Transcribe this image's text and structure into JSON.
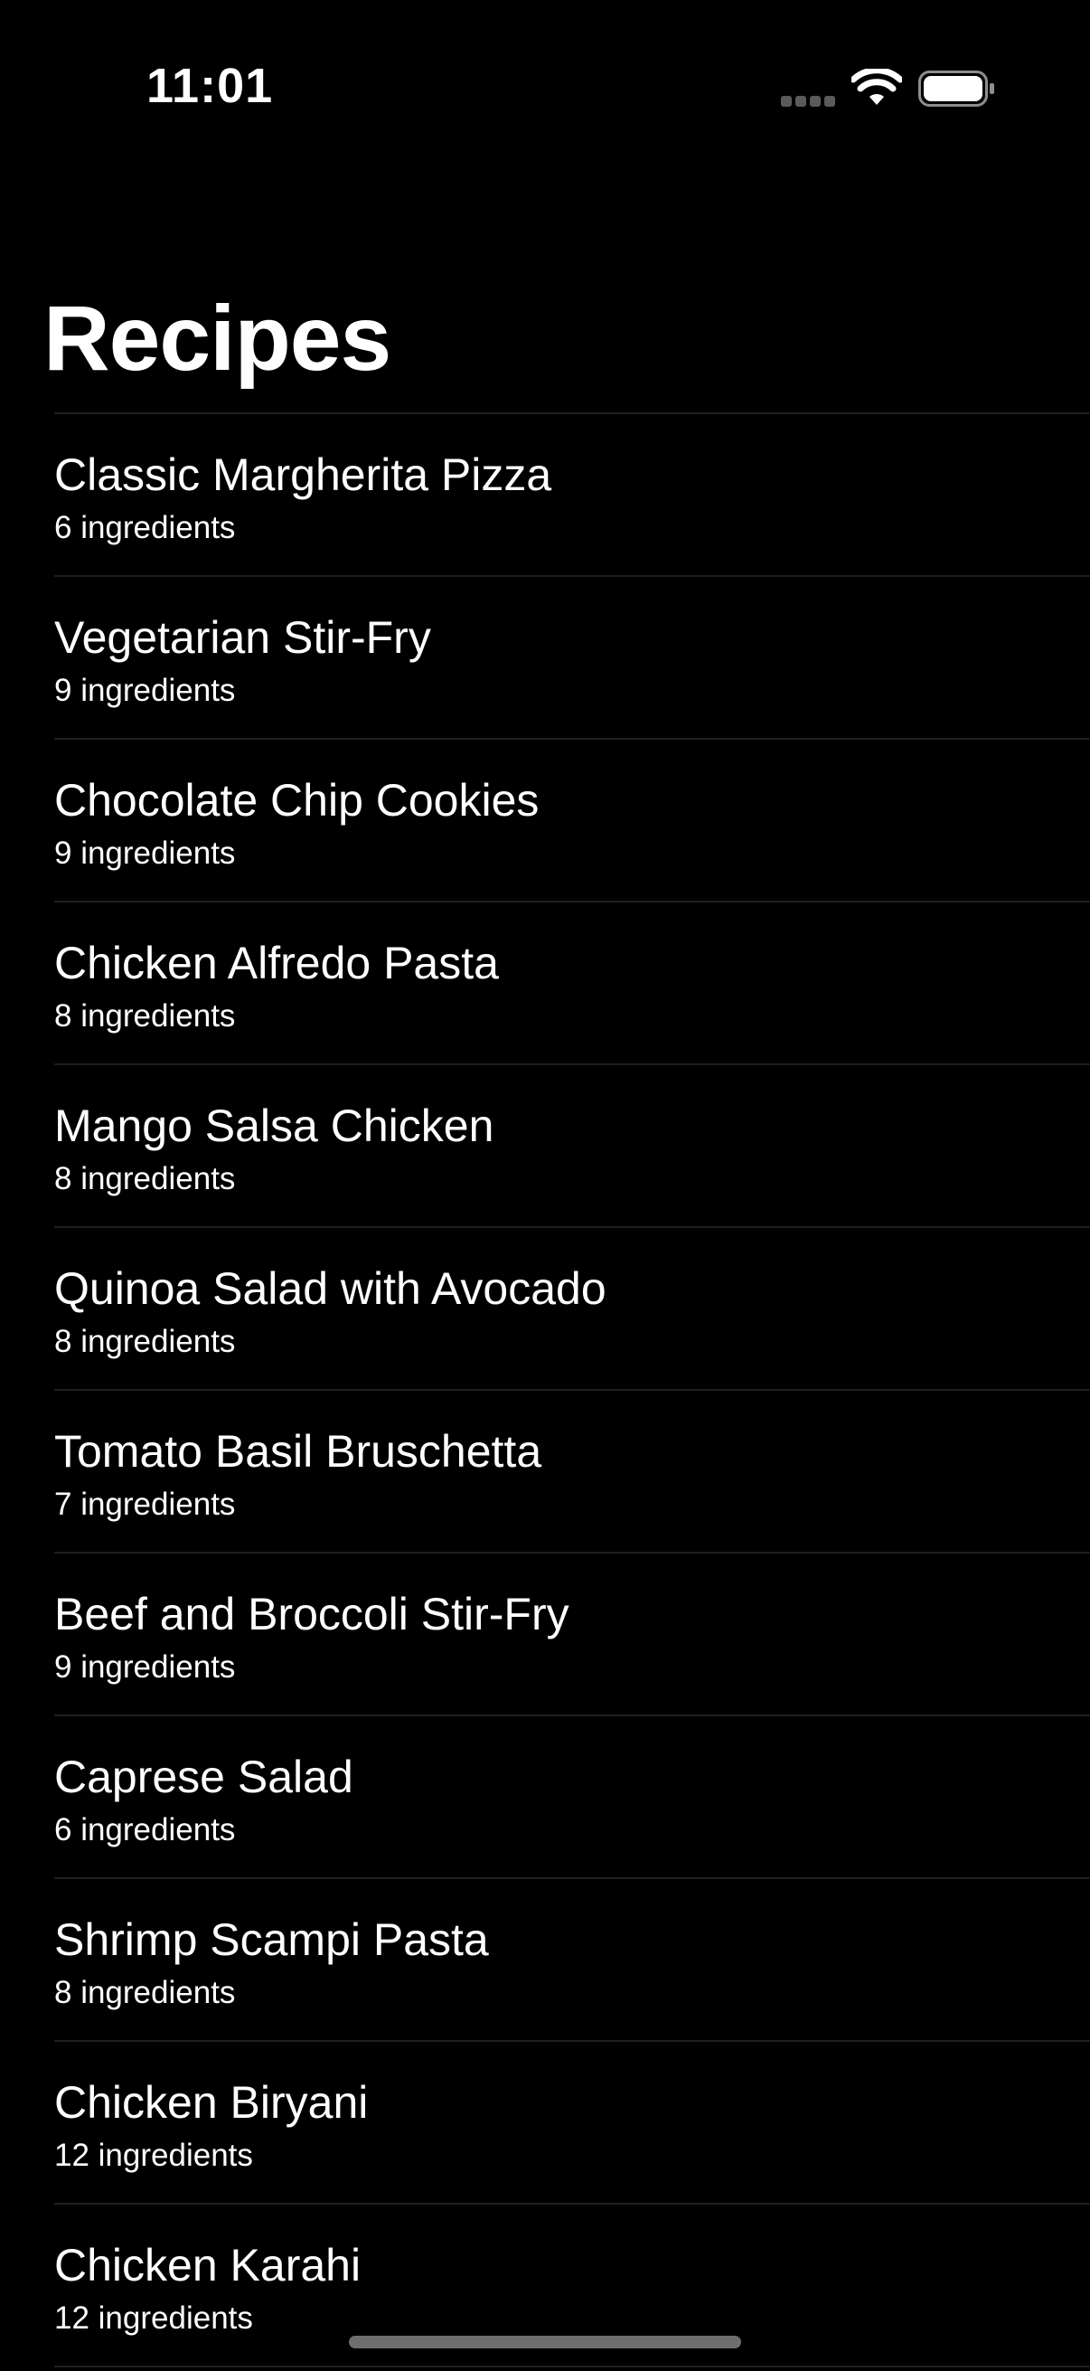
{
  "status_bar": {
    "time": "11:01",
    "icons": [
      "cellular-signal-icon",
      "wifi-icon",
      "battery-icon"
    ]
  },
  "page": {
    "title": "Recipes"
  },
  "recipes": [
    {
      "name": "Classic Margherita Pizza",
      "ingredients": "6 ingredients"
    },
    {
      "name": "Vegetarian Stir-Fry",
      "ingredients": "9 ingredients"
    },
    {
      "name": "Chocolate Chip Cookies",
      "ingredients": "9 ingredients"
    },
    {
      "name": "Chicken Alfredo Pasta",
      "ingredients": "8 ingredients"
    },
    {
      "name": "Mango Salsa Chicken",
      "ingredients": "8 ingredients"
    },
    {
      "name": "Quinoa Salad with Avocado",
      "ingredients": "8 ingredients"
    },
    {
      "name": "Tomato Basil Bruschetta",
      "ingredients": "7 ingredients"
    },
    {
      "name": "Beef and Broccoli Stir-Fry",
      "ingredients": "9 ingredients"
    },
    {
      "name": "Caprese Salad",
      "ingredients": "6 ingredients"
    },
    {
      "name": "Shrimp Scampi Pasta",
      "ingredients": "8 ingredients"
    },
    {
      "name": "Chicken Biryani",
      "ingredients": "12 ingredients"
    },
    {
      "name": "Chicken Karahi",
      "ingredients": "12 ingredients"
    }
  ],
  "colors": {
    "background": "#000000",
    "text": "#ffffff",
    "separator": "#1f1f1f"
  }
}
